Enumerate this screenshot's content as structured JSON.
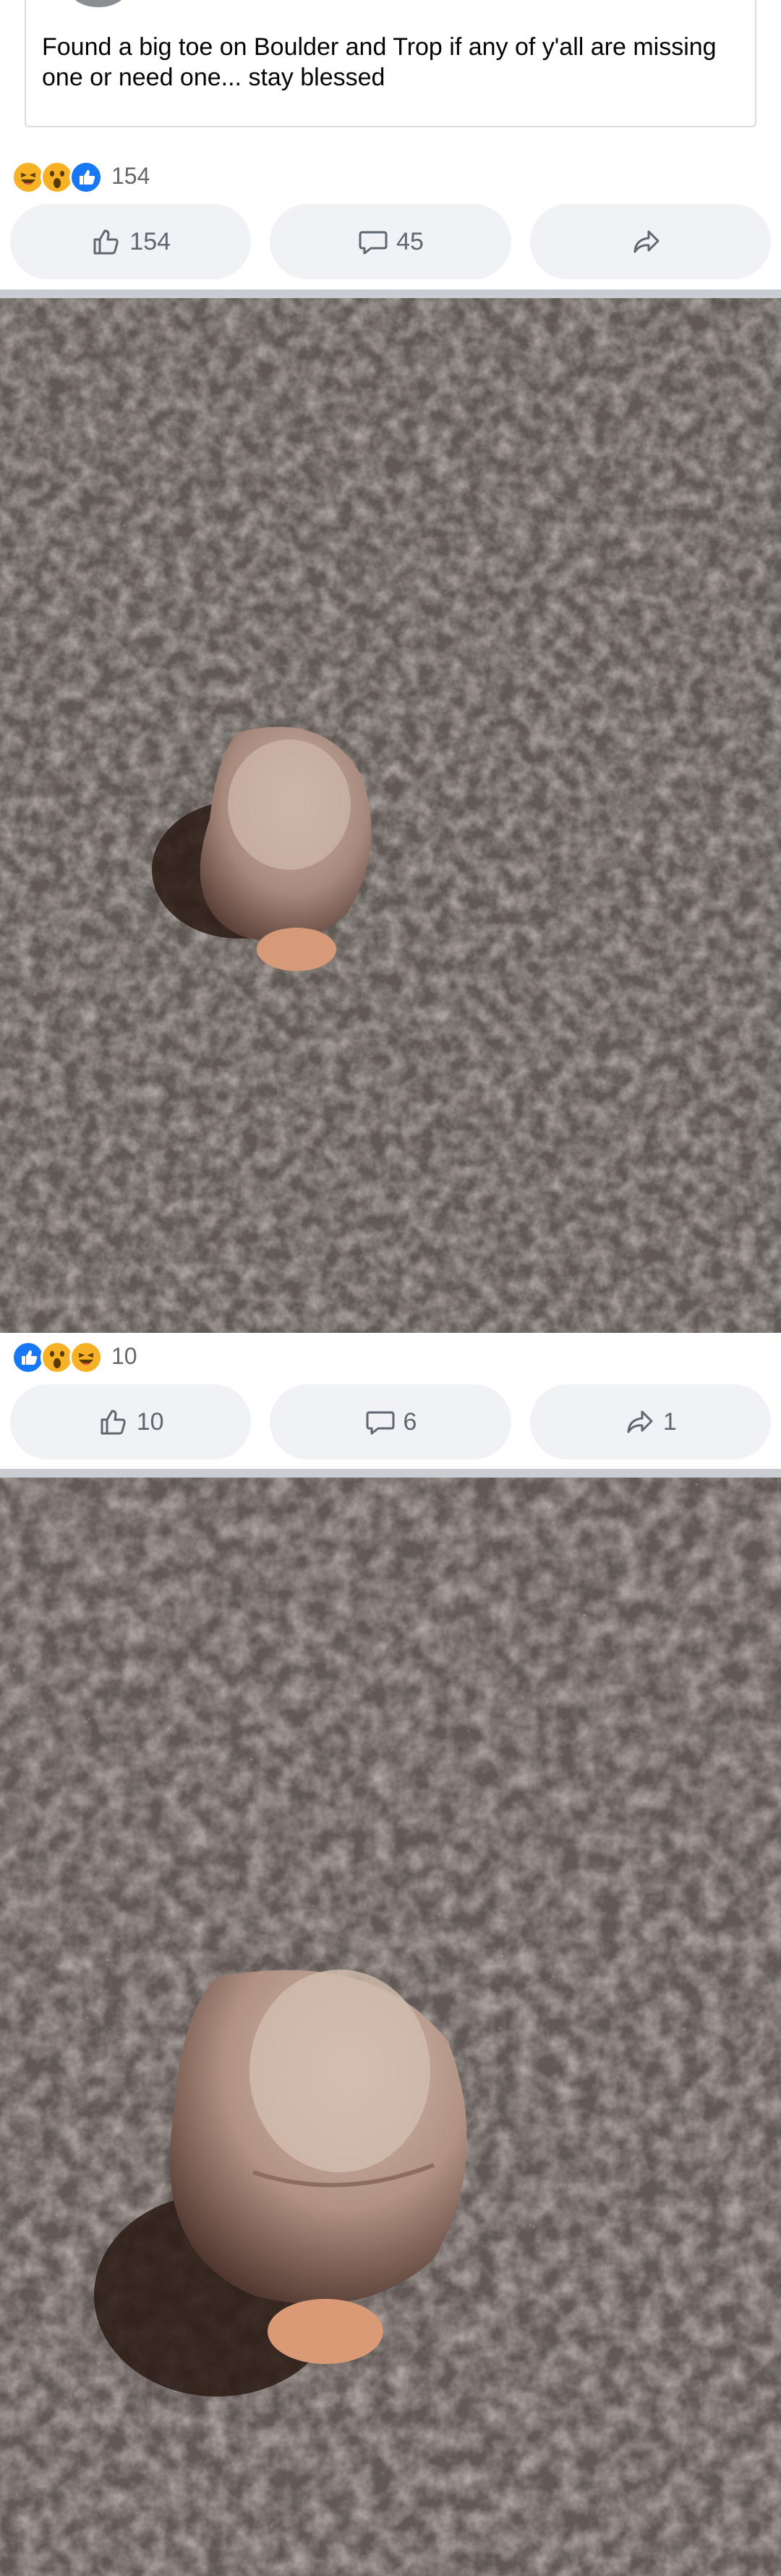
{
  "post": {
    "text": "Found a big toe on Boulder and Trop if any of y'all are missing one or need one... stay blessed",
    "reactions_count": "154",
    "buttons": {
      "like": "154",
      "comment": "45",
      "share": ""
    }
  },
  "photo1": {
    "reactions_count": "10",
    "buttons": {
      "like": "10",
      "comment": "6",
      "share": "1"
    }
  },
  "icons": {
    "haha": "haha-reaction-icon",
    "wow": "wow-reaction-icon",
    "like": "like-reaction-icon",
    "thumb": "thumbs-up-icon",
    "comment": "comment-bubble-icon",
    "share": "share-arrow-icon"
  },
  "colors": {
    "like_blue": "#1877f2",
    "reaction_yellow": "#f7b125",
    "button_bg": "#f0f2f5",
    "divider": "#c9ccd1",
    "asphalt": "#6e6660"
  }
}
